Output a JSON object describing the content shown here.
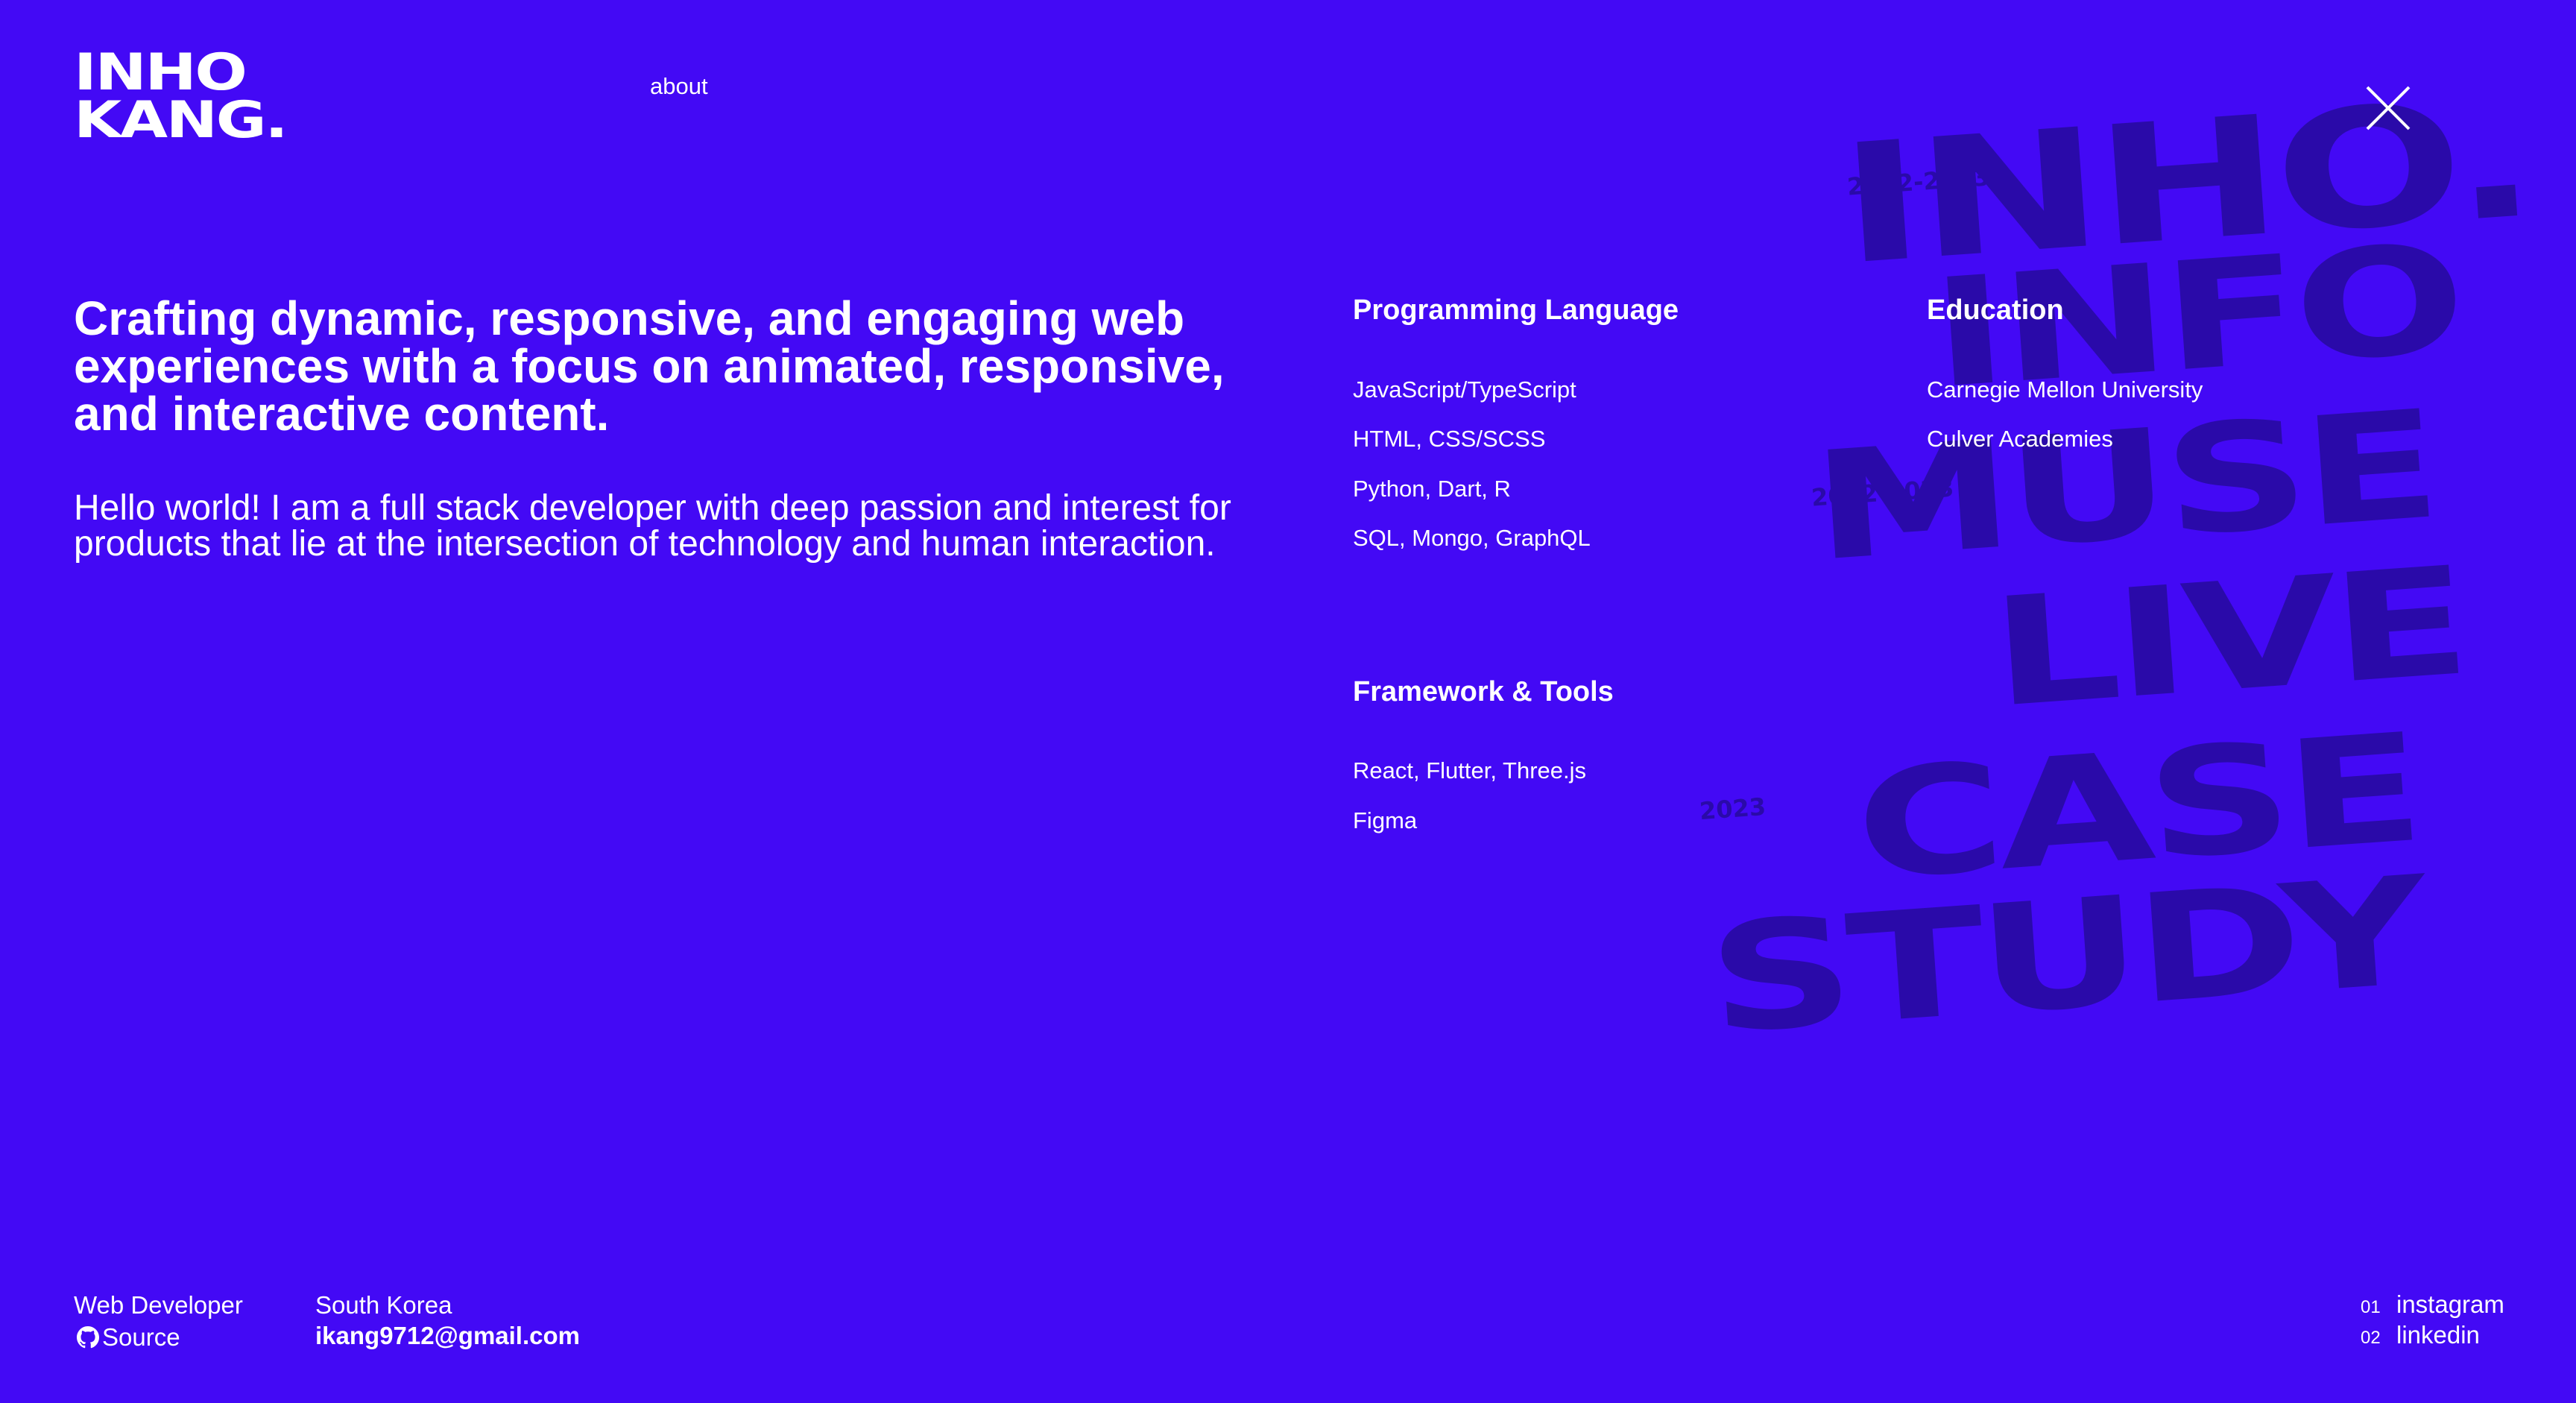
{
  "brand": {
    "line1": "INHO",
    "line2": "KANG."
  },
  "nav": {
    "about_label": "about"
  },
  "hero": {
    "headline": "Crafting dynamic, responsive, and engaging web experiences with a focus on animated, responsive, and interactive content.",
    "bio": "Hello world! I am a full stack developer with deep passion and interest for products that lie at the intersection of technology and human interaction."
  },
  "skills": {
    "programming_title": "Programming Language",
    "programming_items": [
      "JavaScript/TypeScript",
      "HTML, CSS/SCSS",
      "Python, Dart, R",
      "SQL, Mongo, GraphQL"
    ],
    "framework_title": "Framework & Tools",
    "framework_items": [
      "React, Flutter, Three.js",
      "Figma"
    ],
    "education_title": "Education",
    "education_items": [
      "Carnegie Mellon University",
      "Culver Academies"
    ]
  },
  "background_projects": {
    "words": [
      "INHO.",
      "INFO",
      "MUSE",
      "LIVE",
      "CASE",
      "STUDY"
    ],
    "years": [
      "2022-2023",
      "2022-2023",
      "2023"
    ]
  },
  "footer": {
    "role": "Web Developer",
    "source_label": "Source",
    "location": "South Korea",
    "email": "ikang9712@gmail.com",
    "links": [
      {
        "num": "01",
        "label": "instagram"
      },
      {
        "num": "02",
        "label": "linkedin"
      }
    ]
  },
  "colors": {
    "background": "#4309f5",
    "text": "#ffffff",
    "watermark": "#2a0aa9"
  },
  "icons": {
    "close": "close-icon",
    "github": "github-icon"
  }
}
